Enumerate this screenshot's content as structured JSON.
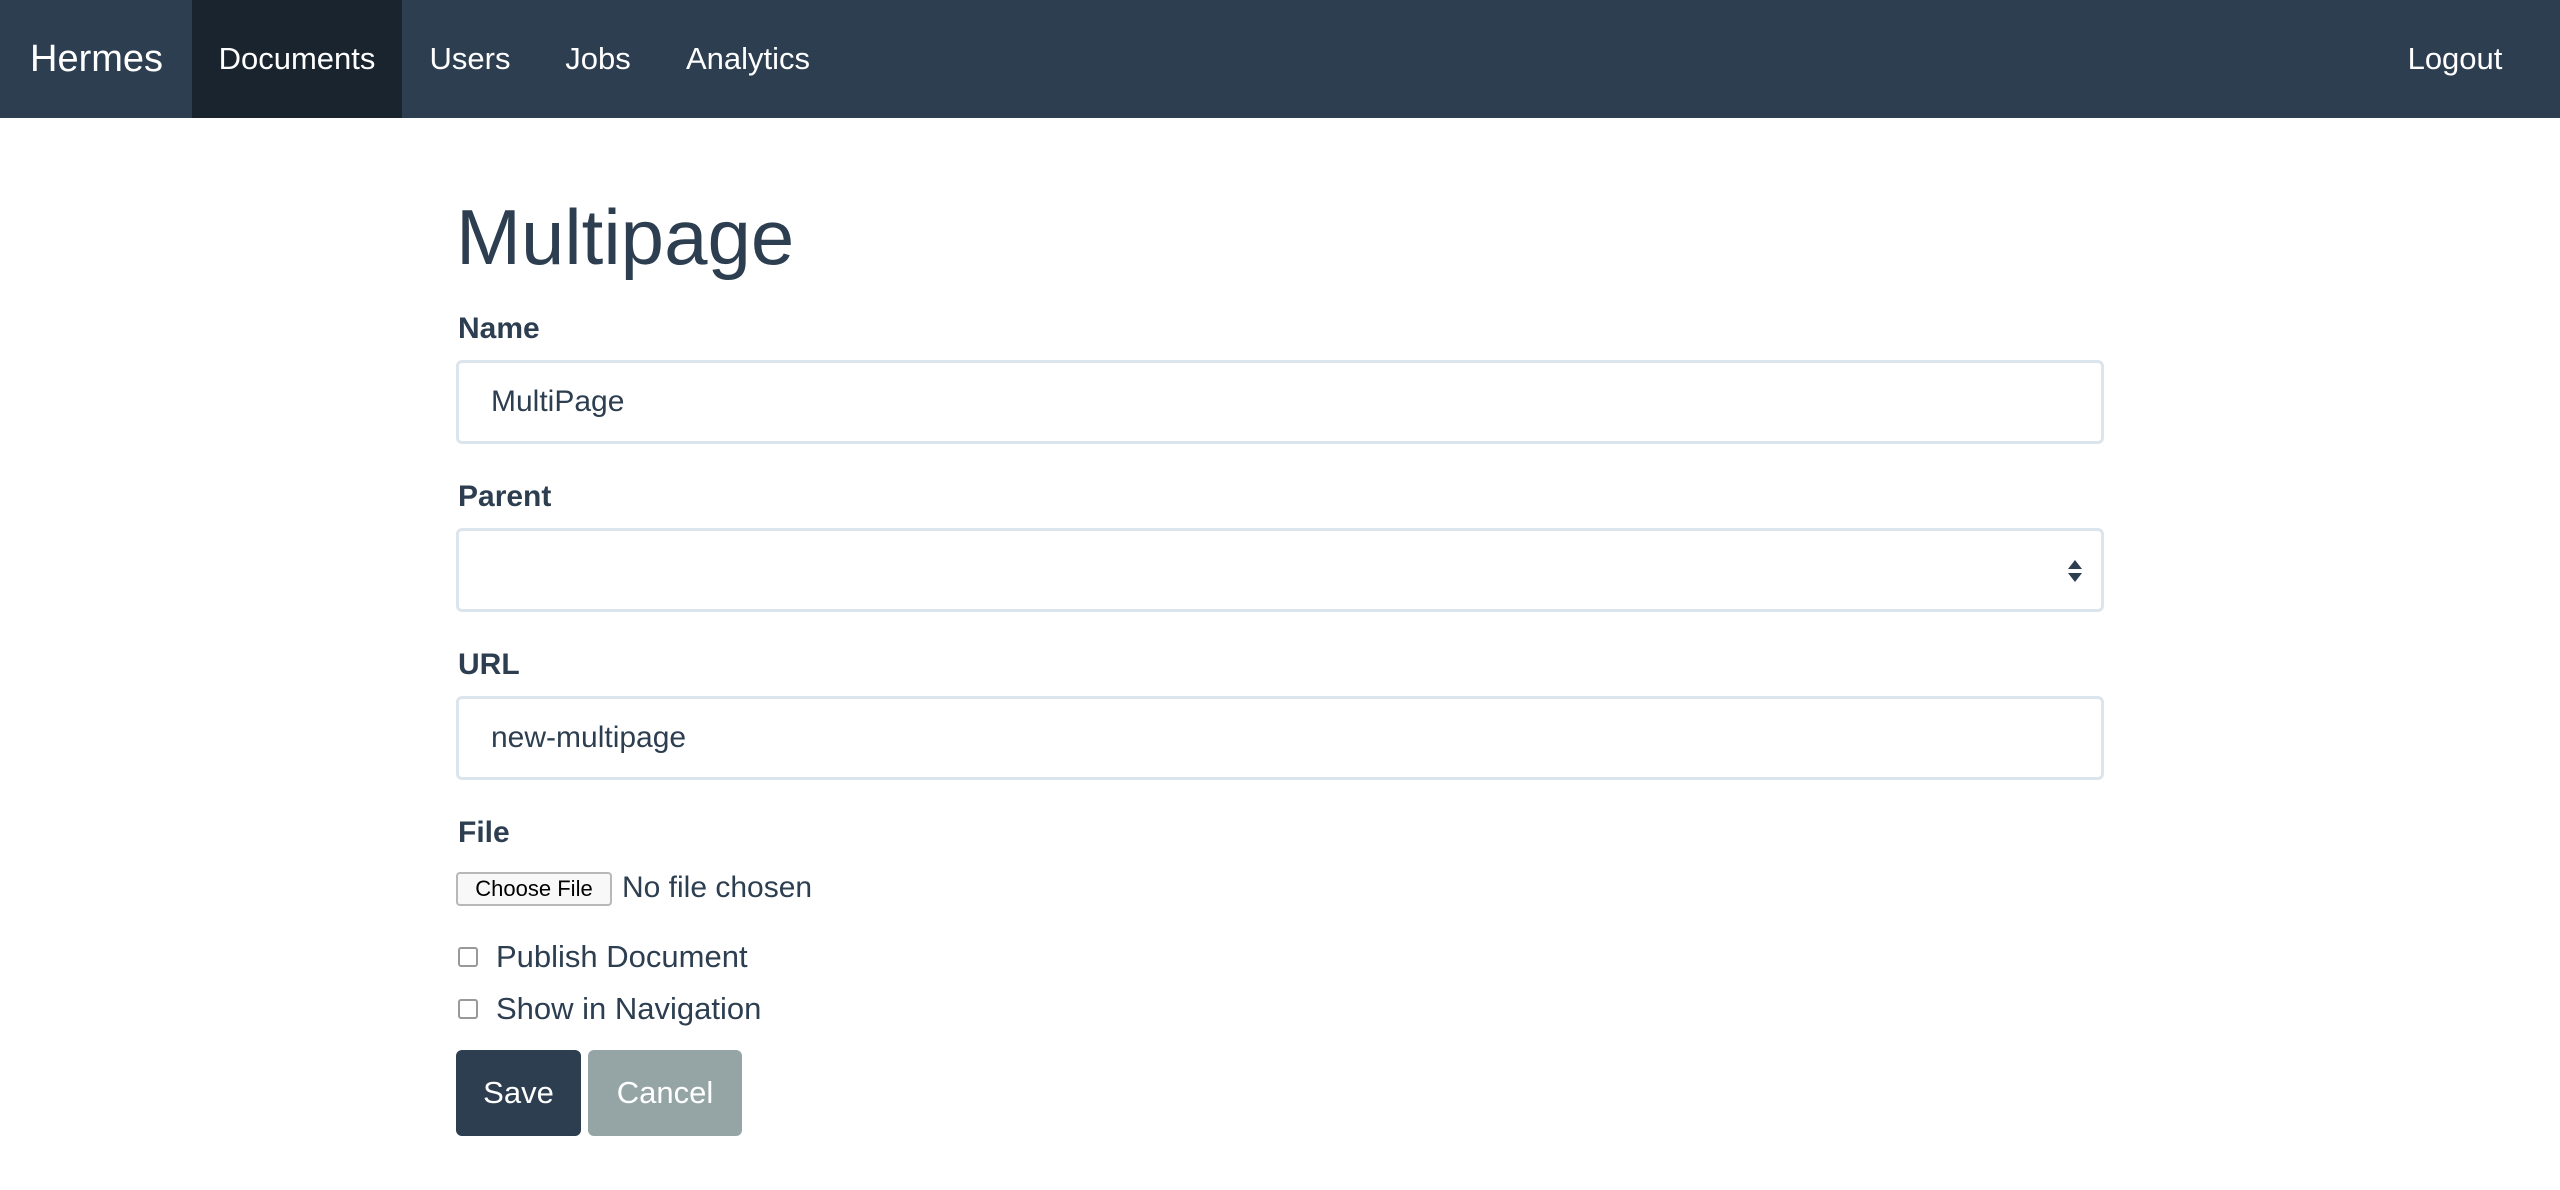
{
  "navbar": {
    "brand": "Hermes",
    "items": [
      {
        "label": "Documents",
        "active": true
      },
      {
        "label": "Users",
        "active": false
      },
      {
        "label": "Jobs",
        "active": false
      },
      {
        "label": "Analytics",
        "active": false
      }
    ],
    "logout": "Logout"
  },
  "page": {
    "title": "Multipage"
  },
  "form": {
    "name_label": "Name",
    "name_value": "MultiPage",
    "parent_label": "Parent",
    "parent_value": "",
    "url_label": "URL",
    "url_value": "new-multipage",
    "file_label": "File",
    "file_button": "Choose File",
    "file_status": "No file chosen",
    "publish_label": "Publish Document",
    "publish_checked": false,
    "nav_label": "Show in Navigation",
    "nav_checked": false,
    "save_label": "Save",
    "cancel_label": "Cancel"
  },
  "colors": {
    "navbar_bg": "#2c3e50",
    "navbar_active": "#1a242f",
    "primary": "#2c3e50",
    "secondary": "#95a5a6",
    "input_border": "#dce4ec"
  },
  "icons": {
    "select_arrows": "updown-arrows-icon"
  }
}
